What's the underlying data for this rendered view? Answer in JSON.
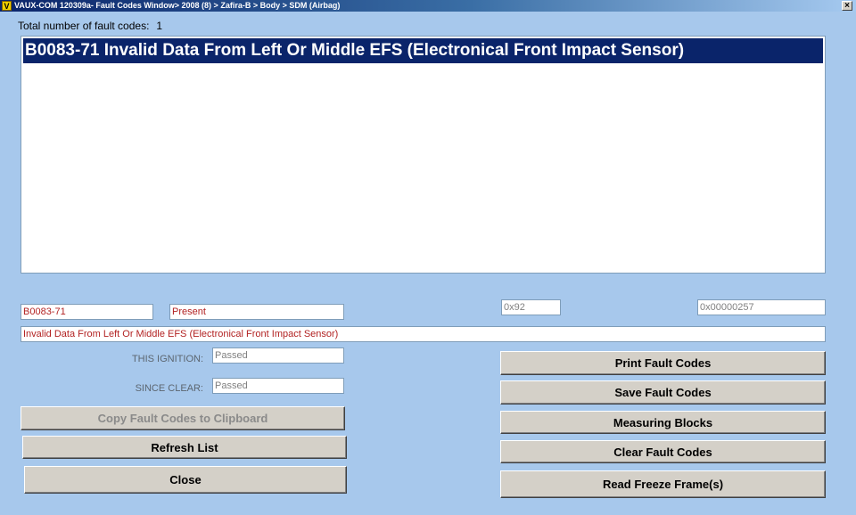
{
  "window": {
    "icon_letter": "V",
    "title": "VAUX-COM 120309a- Fault Codes Window> 2008 (8) > Zafira-B > Body > SDM (Airbag)",
    "close_glyph": "×"
  },
  "summary": {
    "label": "Total number of fault codes:",
    "count": "1"
  },
  "fault_list": [
    "B0083-71 Invalid Data From Left Or Middle EFS (Electronical Front Impact Sensor)"
  ],
  "details": {
    "code": "B0083-71",
    "status": "Present",
    "hex1": "0x92",
    "hex2": "0x00000257",
    "description": "Invalid Data From Left Or Middle EFS (Electronical Front Impact Sensor)",
    "this_ignition_label": "THIS IGNITION:",
    "this_ignition_value": "Passed",
    "since_clear_label": "SINCE CLEAR:",
    "since_clear_value": "Passed"
  },
  "buttons": {
    "copy": "Copy Fault Codes to Clipboard",
    "refresh": "Refresh List",
    "close": "Close",
    "print": "Print Fault Codes",
    "save": "Save Fault Codes",
    "measuring": "Measuring Blocks",
    "clear": "Clear Fault Codes",
    "freeze": "Read Freeze Frame(s)"
  }
}
